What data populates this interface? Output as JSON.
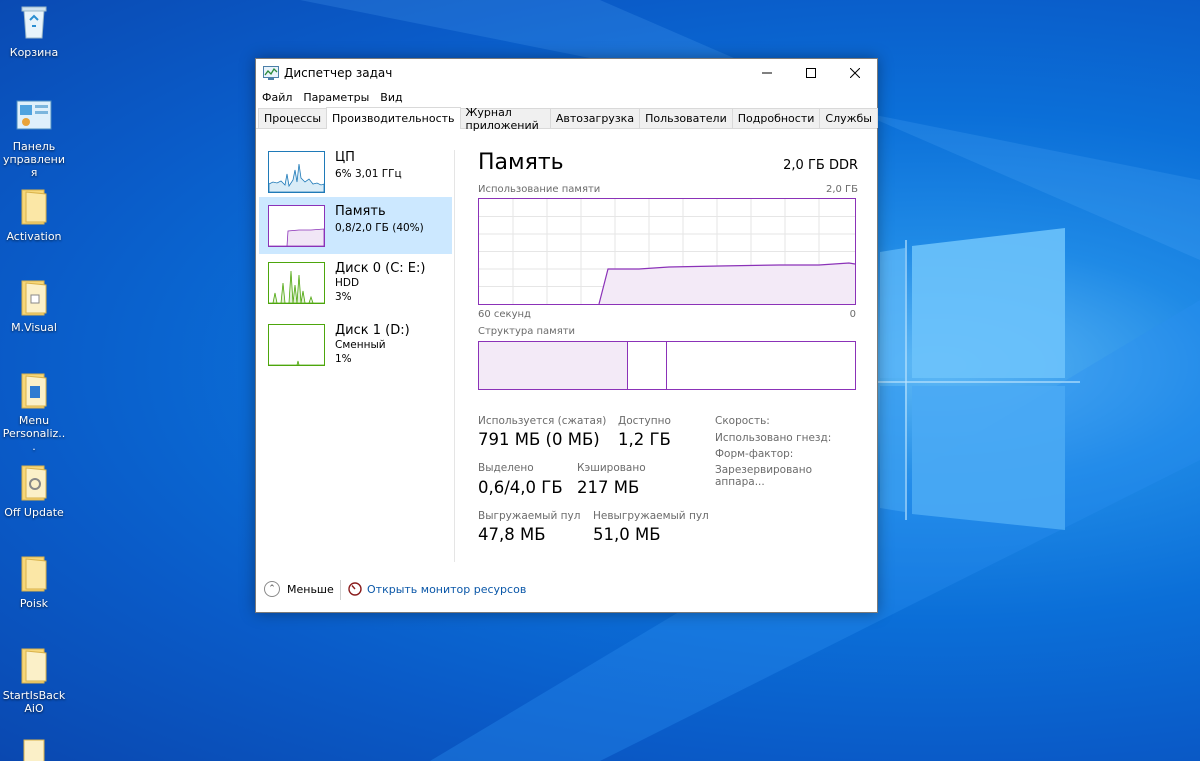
{
  "desktop": {
    "icons": [
      {
        "label": "Корзина"
      },
      {
        "label": "Панель управления"
      },
      {
        "label": "Activation"
      },
      {
        "label": "M.Visual"
      },
      {
        "label": "Menu Personaliz..."
      },
      {
        "label": "Off Update"
      },
      {
        "label": "Poisk"
      },
      {
        "label": "StartIsBack AiO"
      }
    ]
  },
  "window": {
    "title": "Диспетчер задач",
    "controls": {
      "minimize": "—",
      "maximize": "☐",
      "close": "✕"
    },
    "menu": [
      "Файл",
      "Параметры",
      "Вид"
    ],
    "tabs": [
      "Процессы",
      "Производительность",
      "Журнал приложений",
      "Автозагрузка",
      "Пользователи",
      "Подробности",
      "Службы"
    ],
    "active_tab": "Производительность"
  },
  "sidebar": {
    "items": [
      {
        "name": "ЦП",
        "line1": "6% 3,01 ГГц",
        "line2": "",
        "color": "#1f7ab8"
      },
      {
        "name": "Память",
        "line1": "0,8/2,0 ГБ (40%)",
        "line2": "",
        "color": "#8b32b8",
        "selected": true
      },
      {
        "name": "Диск 0 (C: E:)",
        "line1": "HDD",
        "line2": "3%",
        "color": "#4da60c"
      },
      {
        "name": "Диск 1 (D:)",
        "line1": "Сменный",
        "line2": "1%",
        "color": "#4da60c"
      }
    ]
  },
  "memory": {
    "title": "Память",
    "type": "2,0 ГБ DDR",
    "usage_label": "Использование памяти",
    "usage_max": "2,0 ГБ",
    "time_left": "60 секунд",
    "time_right": "0",
    "structure_label": "Структура памяти",
    "in_use_fraction": 0.395,
    "modified_fraction": 0.105,
    "stats": {
      "in_use_label": "Используется (сжатая)",
      "in_use_value": "791 МБ (0 МБ)",
      "available_label": "Доступно",
      "available_value": "1,2 ГБ",
      "committed_label": "Выделено",
      "committed_value": "0,6/4,0 ГБ",
      "cached_label": "Кэшировано",
      "cached_value": "217 МБ",
      "paged_label": "Выгружаемый пул",
      "paged_value": "47,8 МБ",
      "nonpaged_label": "Невыгружаемый пул",
      "nonpaged_value": "51,0 МБ"
    },
    "right": {
      "speed": "Скорость:",
      "slots": "Использовано гнезд:",
      "form": "Форм-фактор:",
      "reserved": "Зарезервировано аппара..."
    }
  },
  "footer": {
    "less": "Меньше",
    "monitor": "Открыть монитор ресурсов"
  }
}
